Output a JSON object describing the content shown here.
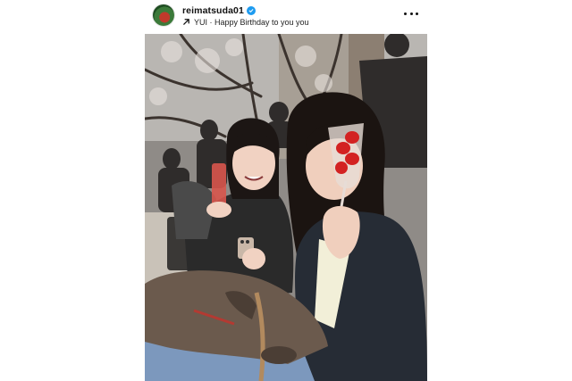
{
  "post": {
    "username": "reimatsuda01",
    "verified": true,
    "music": "YUI · Happy Birthday to you you",
    "verified_color": "#1d9bf0"
  },
  "icons": {
    "avatar": "profile-avatar",
    "verified": "verified-badge-icon",
    "music": "arrow-up-right-icon",
    "more": "more-options-icon"
  }
}
